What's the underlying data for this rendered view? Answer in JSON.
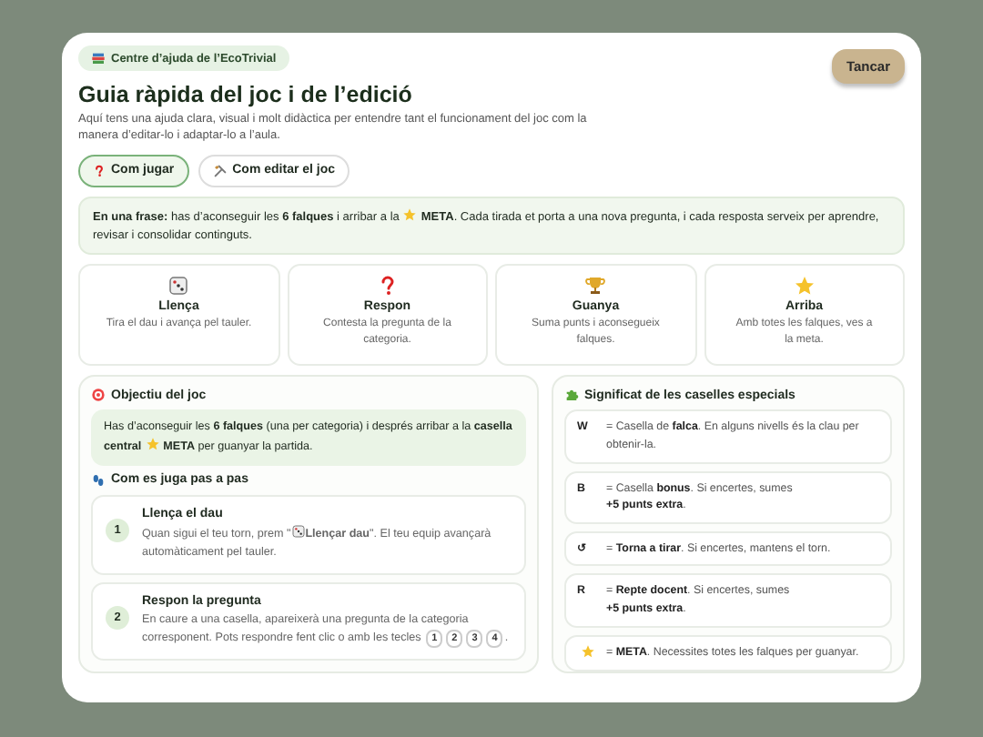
{
  "badge": "Centre d’ajuda de l’EcoTrivial",
  "close_button": "Tancar",
  "title": "Guia ràpida del joc i de l’edició",
  "subtitle": "Aquí tens una ajuda clara, visual i molt didàctica per entendre tant el funcionament del joc com la manera d’editar-lo i adaptar-lo a l’aula.",
  "tabs": [
    {
      "label": "Com jugar",
      "selected": true
    },
    {
      "label": "Com editar el joc",
      "selected": false
    }
  ],
  "summary": {
    "before": "**En una frase:** has d’aconseguir les **6 falques** i arribar a la",
    "after": "**META**. Cada tirada et porta a una nova pregunta, i cada resposta serveix per aprendre, revisar i consolidar continguts."
  },
  "cards": [
    {
      "kind": "dice",
      "title": "Llença",
      "text": "Tira el dau i avança pel tauler."
    },
    {
      "kind": "question",
      "title": "Respon",
      "text": "Contesta la pregunta de la categoria."
    },
    {
      "kind": "trophy",
      "title": "Guanya",
      "text": "Suma punts i aconsegueix falques."
    },
    {
      "kind": "star",
      "title": "Arriba",
      "text": "Amb totes les falques, ves a la meta."
    }
  ],
  "objective": {
    "heading": "Objectiu del joc",
    "before": "Has d’aconseguir les **6 falques** (una per categoria) i després arribar a la **casella central**",
    "after": "**META** per guanyar la partida."
  },
  "steps_heading": "Com es juga pas a pas",
  "steps": [
    {
      "number": "1",
      "title": "Llença el dau",
      "before": "Quan sigui el teu torn, prem \"",
      "after": "**Llençar dau**\". El teu equip avançarà automàticament pel tauler.",
      "kind": "dice"
    },
    {
      "number": "2",
      "title": "Respon la pregunta",
      "before": "En caure a una casella, apareixerà una pregunta de la categoria corresponent. Pots respondre fent clic o amb les tecles",
      "after": ".",
      "kind": "keys",
      "keys": [
        "1",
        "2",
        "3",
        "4"
      ]
    }
  ],
  "legend": {
    "heading": "Significat de les caselles especials",
    "items": [
      {
        "kind": "letter",
        "symbol": "W",
        "text": "= Casella de **falca**. En alguns nivells és la clau per obtenir-la."
      },
      {
        "kind": "letter",
        "symbol": "B",
        "text": "= Casella **bonus**. Si encertes, sumes\n**+5 punts extra**."
      },
      {
        "kind": "letter",
        "symbol": "↺",
        "text": "= **Torna a tirar**. Si encertes, mantens el torn."
      },
      {
        "kind": "letter",
        "symbol": "R",
        "text": "= **Repte docent**. Si encertes, sumes\n**+5 punts extra**."
      },
      {
        "kind": "star",
        "text": "= **META**. Necessites totes les falques per guanyar."
      }
    ]
  }
}
